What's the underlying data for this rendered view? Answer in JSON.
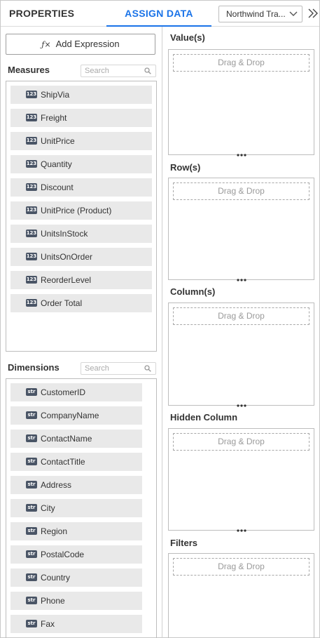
{
  "header": {
    "tabs": [
      {
        "label": "PROPERTIES",
        "active": false
      },
      {
        "label": "ASSIGN DATA",
        "active": true
      }
    ],
    "datasource": "Northwind Tra...",
    "collapse_icon": "double-chevron-right-icon",
    "active_color": "#1a73e8"
  },
  "add_expression": {
    "label": "Add Expression",
    "icon": "fx-icon"
  },
  "measures": {
    "title": "Measures",
    "search_placeholder": "Search",
    "badge": "123",
    "items": [
      "ShipVia",
      "Freight",
      "UnitPrice",
      "Quantity",
      "Discount",
      "UnitPrice (Product)",
      "UnitsInStock",
      "UnitsOnOrder",
      "ReorderLevel",
      "Order Total"
    ]
  },
  "dimensions": {
    "title": "Dimensions",
    "search_placeholder": "Search",
    "badge": "str",
    "items": [
      "CustomerID",
      "CompanyName",
      "ContactName",
      "ContactTitle",
      "Address",
      "City",
      "Region",
      "PostalCode",
      "Country",
      "Phone",
      "Fax"
    ]
  },
  "zones": [
    {
      "title": "Value(s)",
      "drop_label": "Drag & Drop"
    },
    {
      "title": "Row(s)",
      "drop_label": "Drag & Drop"
    },
    {
      "title": "Column(s)",
      "drop_label": "Drag & Drop"
    },
    {
      "title": "Hidden Column",
      "drop_label": "Drag & Drop"
    },
    {
      "title": "Filters",
      "drop_label": "Drag & Drop"
    }
  ]
}
